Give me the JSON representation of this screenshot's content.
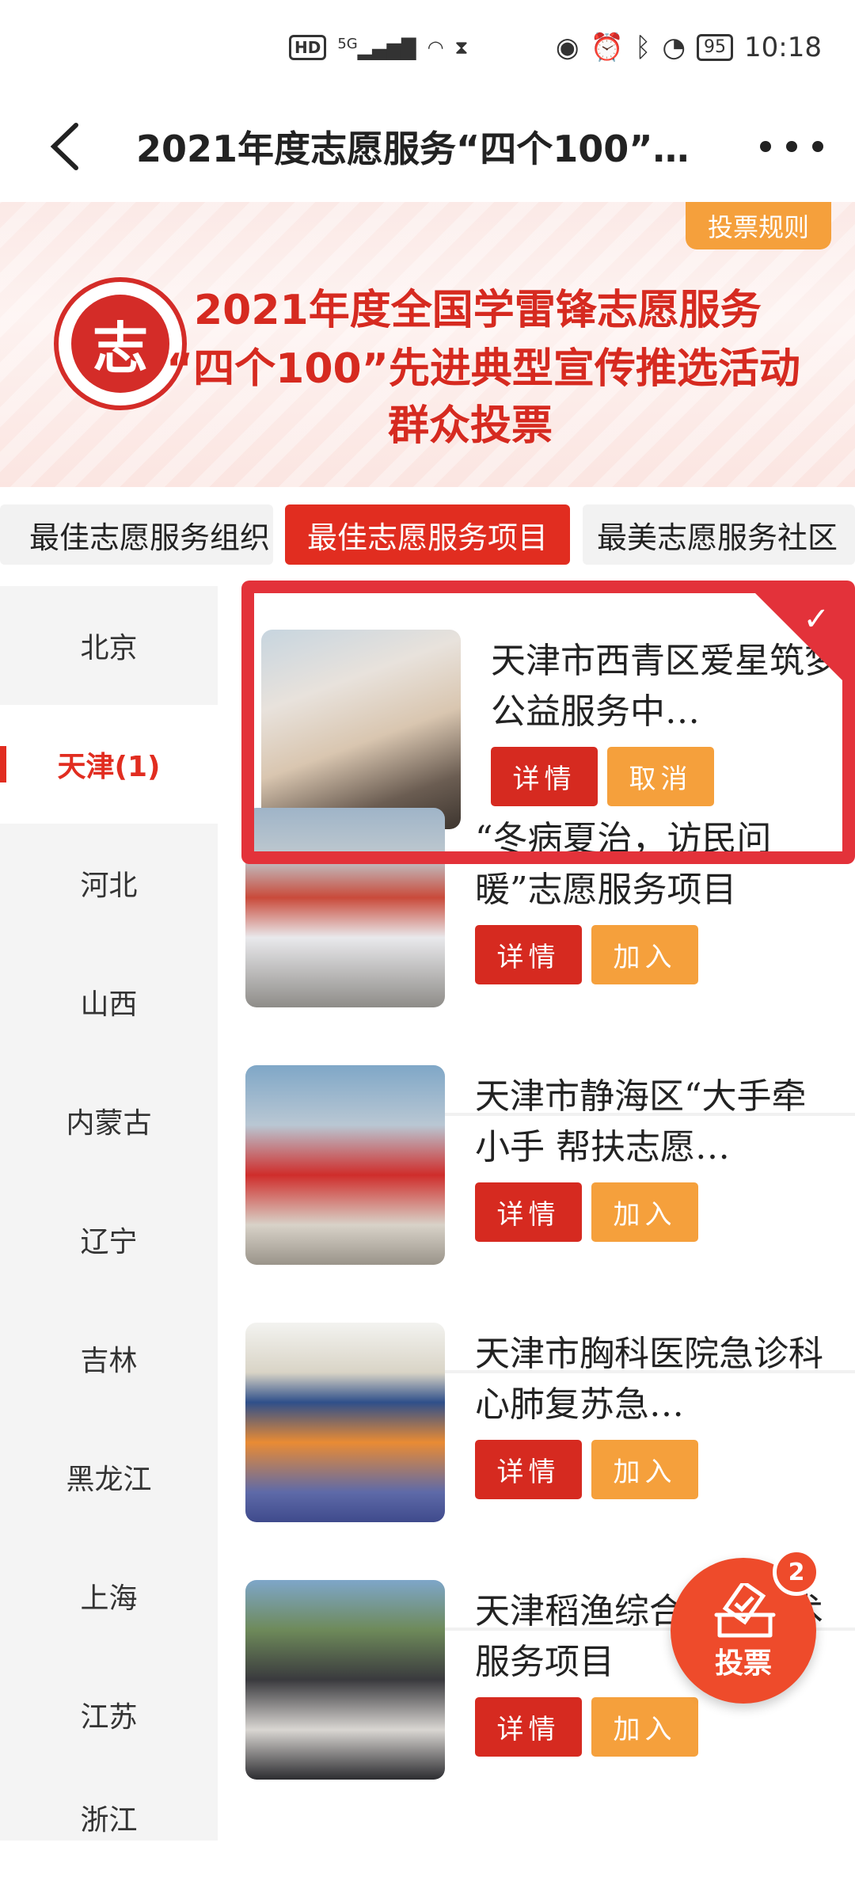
{
  "status_bar": {
    "hd": "HD",
    "network": "5G",
    "battery": "95",
    "time": "10:18"
  },
  "header": {
    "title": "2021年度志愿服务“四个100”…"
  },
  "banner": {
    "rules_button": "投票规则",
    "logo_char": "志",
    "line1": "2021年度全国学雷锋志愿服务",
    "line2": "“四个100”先进典型宣传推选活动",
    "line3": "群众投票"
  },
  "tabs": [
    {
      "label": "最佳志愿服务组织",
      "active": false
    },
    {
      "label": "最佳志愿服务项目",
      "active": true
    },
    {
      "label": "最美志愿服务社区",
      "active": false
    }
  ],
  "sidebar": {
    "items": [
      "北京",
      "天津(1)",
      "河北",
      "山西",
      "内蒙古",
      "辽宁",
      "吉林",
      "黑龙江",
      "上海",
      "江苏",
      "浙江"
    ],
    "active_index": 1
  },
  "items": [
    {
      "title": "天津市西青区爱星筑梦公益服务中…",
      "detail": "详情",
      "action": "取消",
      "selected": true
    },
    {
      "title": "“冬病夏治，访民问暖”志愿服务项目",
      "detail": "详情",
      "action": "加入",
      "selected": false
    },
    {
      "title": "天津市静海区“大手牵小手 帮扶志愿…",
      "detail": "详情",
      "action": "加入",
      "selected": false
    },
    {
      "title": "天津市胸科医院急诊科心肺复苏急…",
      "detail": "详情",
      "action": "加入",
      "selected": false
    },
    {
      "title": "天津稻渔综合种养技术服务项目",
      "detail": "详情",
      "action": "加入",
      "selected": false
    }
  ],
  "vote_fab": {
    "label": "投票",
    "count": "2"
  },
  "colors": {
    "primary": "#e12d20",
    "accent": "#f5a03c",
    "fab": "#ee4b2b"
  }
}
